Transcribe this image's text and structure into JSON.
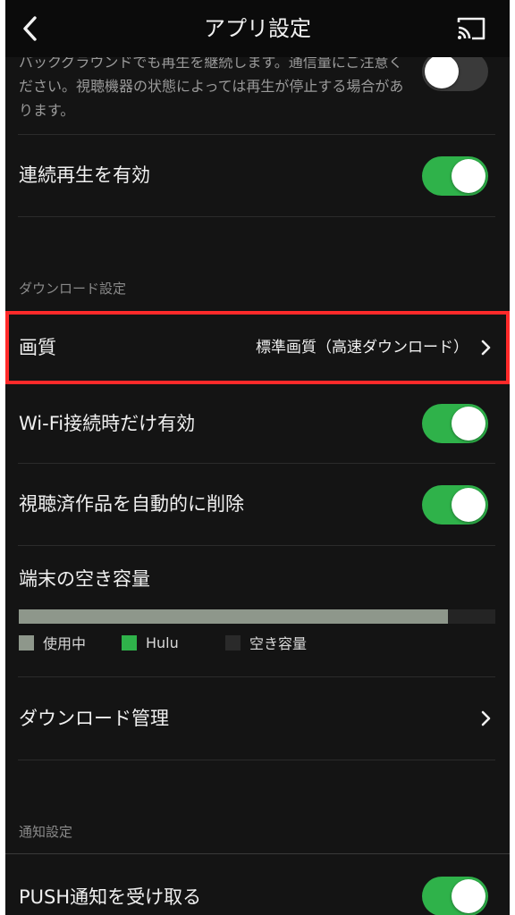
{
  "header": {
    "title": "アプリ設定",
    "back_icon": "chevron-left-icon",
    "cast_icon": "cast-icon"
  },
  "background_playback": {
    "description": "バックグラウンドでも再生を継続します。通信量にご注意ください。視聴機器の状態によっては再生が停止する場合があります。",
    "enabled": false
  },
  "continuous_playback": {
    "label": "連続再生を有効",
    "enabled": true
  },
  "download_section": {
    "header": "ダウンロード設定",
    "quality": {
      "label": "画質",
      "value": "標準画質（高速ダウンロード）",
      "highlight_color": "#ff2a2a"
    },
    "wifi_only": {
      "label": "Wi-Fi接続時だけ有効",
      "enabled": true
    },
    "auto_delete": {
      "label": "視聴済作品を自動的に削除",
      "enabled": true
    },
    "storage": {
      "label": "端末の空き容量",
      "used_fraction": 0.9,
      "hulu_fraction": 0.0,
      "legend": [
        {
          "label": "使用中",
          "color": "#8e978b"
        },
        {
          "label": "Hulu",
          "color": "#2fb24a"
        },
        {
          "label": "空き容量",
          "color": "#2a2a2a"
        }
      ]
    },
    "manage": {
      "label": "ダウンロード管理"
    }
  },
  "notification_section": {
    "header": "通知設定",
    "push": {
      "label": "PUSH通知を受け取る",
      "enabled": true
    }
  },
  "colors": {
    "accent_green": "#2fb24a",
    "background": "#141414",
    "header_bg": "#0b0b0b"
  }
}
